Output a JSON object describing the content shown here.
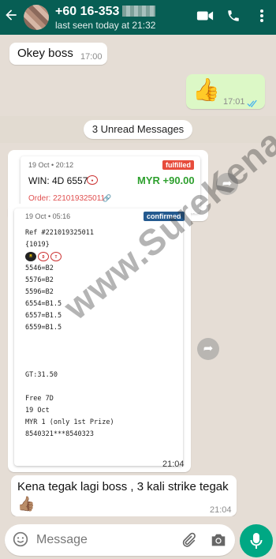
{
  "header": {
    "contact": "+60 16-353",
    "last_seen": "last seen today at 21:32",
    "back_icon": "arrow-left-icon",
    "video_icon": "video-call-icon",
    "call_icon": "phone-icon",
    "menu_icon": "more-vertical-icon"
  },
  "messages": [
    {
      "text": "Okey boss",
      "time": "17:00"
    },
    {
      "emoji": "👍",
      "time": "17:01"
    }
  ],
  "unread_label": "3 Unread Messages",
  "win_card": {
    "date": "19 Oct • 20:12",
    "status": "fulfilled",
    "win": "WIN: 4D 6557",
    "amount": "MYR +90.00",
    "order": "Order: 221019325011",
    "time": "21:04"
  },
  "bet_card": {
    "date": "19 Oct • 05:16",
    "status": "confirmed",
    "lines": [
      "Ref #221019325011",
      "",
      "{1019}",
      "",
      "5546=B2",
      "5576=B2",
      "5596=B2",
      "6554=B1.5",
      "6557=B1.5",
      "6559=B1.5",
      "",
      "",
      "",
      "GT:31.50",
      "",
      "Free 7D",
      "19 Oct",
      "MYR 1 (only 1st Prize)",
      "8540321***8540323"
    ],
    "time": "21:04",
    "logos": [
      "Magnum",
      "Damacai",
      "Toto"
    ]
  },
  "last_message": {
    "text": "Kena tegak lagi boss , 3 kali strike tegak",
    "emoji": "👍🏽",
    "time": "21:04"
  },
  "watermark": "www.SureKena.com",
  "input": {
    "placeholder": "Message"
  },
  "colors": {
    "header": "#075e54",
    "background": "#e5ddd5",
    "outgoing": "#dcf8c6",
    "accent": "#00a884"
  }
}
